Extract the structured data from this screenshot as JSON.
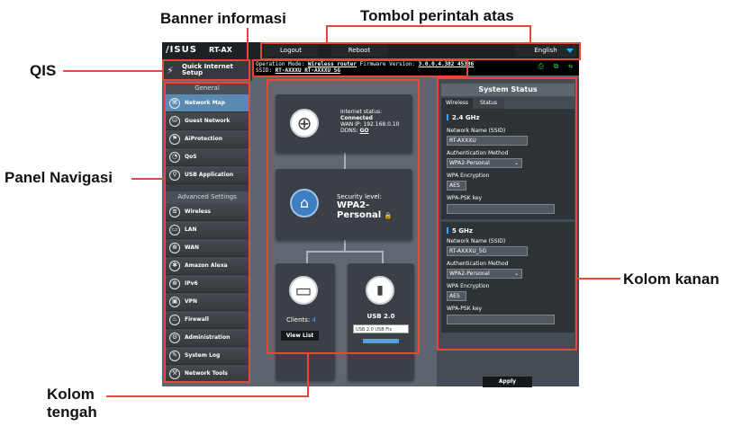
{
  "callouts": {
    "banner": "Banner informasi",
    "top_buttons": "Tombol perintah atas",
    "qis": "QIS",
    "nav_panel": "Panel Navigasi",
    "right_col": "Kolom kanan",
    "center_col_line1": "Kolom",
    "center_col_line2": "tengah"
  },
  "header": {
    "logo": "/ISUS",
    "model": "RT-AX",
    "logout": "Logout",
    "reboot": "Reboot",
    "language": "English"
  },
  "banner": {
    "op_mode_label": "Operation Mode:",
    "op_mode": "Wireless router",
    "fw_label": "Firmware Version:",
    "fw": "3.0.0.4.382_45386",
    "ssid_label": "SSID:",
    "ssid": "RT-AXXXU RT-AXXXU_5G",
    "icons": "⎙ ⧉ ⇆"
  },
  "qis": {
    "line1": "Quick Internet",
    "line2": "Setup",
    "icon": "wand-icon"
  },
  "nav": {
    "general_header": "General",
    "general": [
      {
        "label": "Network Map",
        "icon": "⌘"
      },
      {
        "label": "Guest Network",
        "icon": "⛁"
      },
      {
        "label": "AiProtection",
        "icon": "⚑"
      },
      {
        "label": "QoS",
        "icon": "◔"
      },
      {
        "label": "USB Application",
        "icon": "⚲"
      }
    ],
    "advanced_header": "Advanced Settings",
    "advanced": [
      {
        "label": "Wireless",
        "icon": "≋"
      },
      {
        "label": "LAN",
        "icon": "▭"
      },
      {
        "label": "WAN",
        "icon": "⊕"
      },
      {
        "label": "Amazon Alexa",
        "icon": "✱"
      },
      {
        "label": "IPv6",
        "icon": "⊛"
      },
      {
        "label": "VPN",
        "icon": "▣"
      },
      {
        "label": "Firewall",
        "icon": "♨"
      },
      {
        "label": "Administration",
        "icon": "⚙"
      },
      {
        "label": "System Log",
        "icon": "✎"
      },
      {
        "label": "Network Tools",
        "icon": "⚒"
      }
    ]
  },
  "center": {
    "internet": {
      "status_label": "Internet status:",
      "status": "Connected",
      "wan_ip": "WAN IP: 192.168.0.10",
      "ddns_label": "DDNS:",
      "ddns": "GO"
    },
    "security": {
      "label": "Security level:",
      "value": "WPA2-Personal",
      "lock": "🔒"
    },
    "clients": {
      "label": "Clients:",
      "count": "4",
      "view_list": "View List"
    },
    "usb": {
      "title": "USB 2.0",
      "select": "USB 2.0 USB Fls"
    }
  },
  "status": {
    "title": "System Status",
    "tabs": [
      "Wireless",
      "Status"
    ],
    "band24": {
      "title": "2.4 GHz",
      "ssid_label": "Network Name (SSID)",
      "ssid": "RT-AXXXU",
      "auth_label": "Authentication Method",
      "auth": "WPA2-Personal",
      "enc_label": "WPA Encryption",
      "enc": "AES",
      "psk_label": "WPA-PSK key"
    },
    "band5": {
      "title": "5 GHz",
      "ssid_label": "Network Name (SSID)",
      "ssid": "RT-AXXXU_5G",
      "auth_label": "Authentication Method",
      "auth": "WPA2-Personal",
      "enc_label": "WPA Encryption",
      "enc": "AES",
      "psk_label": "WPA-PSK key"
    },
    "apply": "Apply"
  },
  "colors": {
    "accent": "#e8463a",
    "blue": "#3aa1ff"
  }
}
